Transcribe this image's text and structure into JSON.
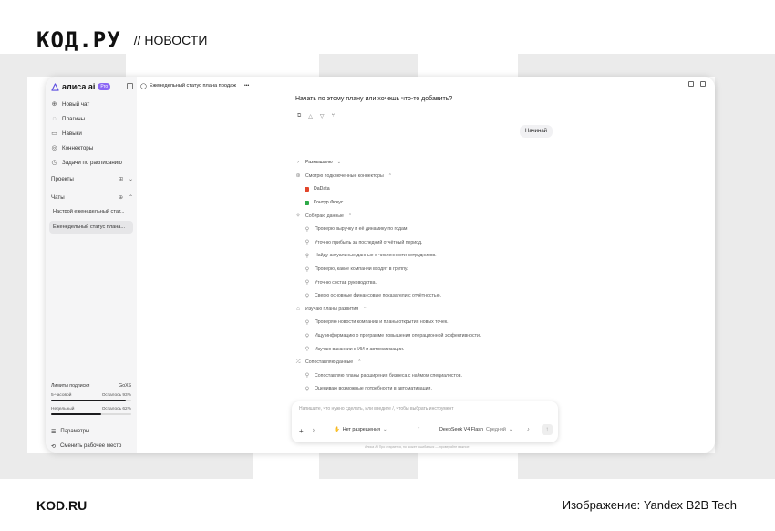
{
  "header": {
    "logo": "КОД.РУ",
    "section": "// НОВОСТИ"
  },
  "footer": {
    "site": "KOD.RU",
    "credit": "Изображение: Yandex B2B Tech"
  },
  "sidebar": {
    "logo_text": "алиса ai",
    "badge": "Pro",
    "nav": [
      {
        "label": "Новый чат",
        "icon": "plus-chat-icon"
      },
      {
        "label": "Плагины",
        "icon": "plugin-icon"
      },
      {
        "label": "Навыки",
        "icon": "book-icon"
      },
      {
        "label": "Коннекторы",
        "icon": "connector-icon"
      },
      {
        "label": "Задачи по расписанию",
        "icon": "clock-icon"
      }
    ],
    "projects_label": "Проекты",
    "chats_label": "Чаты",
    "chats": [
      {
        "label": "Настрой еженедельный стат..."
      },
      {
        "label": "Еженедельный статус плана..."
      }
    ],
    "limits": {
      "title": "Лимиты подписки",
      "plan": "GoXS",
      "rows": [
        {
          "label": "5-часовой",
          "value": "Осталось 93%",
          "fill": 0.93
        },
        {
          "label": "Недельный",
          "value": "Осталось 62%",
          "fill": 0.62
        }
      ]
    },
    "settings_label": "Параметры",
    "workspace_label": "Сменить рабочее место"
  },
  "main": {
    "chat_title": "Еженедельный статус плана продаж",
    "more": "•••",
    "question": "Начать по этому плану или хочешь что-то добавить?",
    "user_message": "Начинай",
    "thinking_label": "Размышляю",
    "steps": [
      {
        "kind": "group",
        "icon": "plug-icon",
        "text": "Смотрю подключенные коннекторы"
      },
      {
        "kind": "source",
        "color": "#e2452a",
        "text": "DaData"
      },
      {
        "kind": "source",
        "color": "#2eaa48",
        "text": "Контур.Фокус"
      },
      {
        "kind": "group",
        "icon": "sparkle-icon",
        "text": "Собираю данные"
      },
      {
        "kind": "item",
        "text": "Проверю выручку и её динамику по годам."
      },
      {
        "kind": "item",
        "text": "Уточню прибыль за последний отчётный период."
      },
      {
        "kind": "item",
        "text": "Найду актуальные данные о численности сотрудников."
      },
      {
        "kind": "item",
        "text": "Проверю, какие компании входят в группу."
      },
      {
        "kind": "item",
        "text": "Уточню состав руководства."
      },
      {
        "kind": "item",
        "text": "Сверю основные финансовые показатели с отчётностью."
      },
      {
        "kind": "group",
        "icon": "cap-icon",
        "text": "Изучаю планы развития"
      },
      {
        "kind": "item",
        "text": "Проверяю новости компании и планы открытия новых точек."
      },
      {
        "kind": "item",
        "text": "Ищу информацию о программе повышения операционной эффективности."
      },
      {
        "kind": "item",
        "text": "Изучаю вакансии в ИИ и автоматизации."
      },
      {
        "kind": "group",
        "icon": "merge-icon",
        "text": "Сопоставляю данные"
      },
      {
        "kind": "item",
        "text": "Сопоставляю планы расширения бизнеса с наймом специалистов."
      },
      {
        "kind": "item",
        "text": "Оцениваю возможные потребности в автоматизации."
      }
    ],
    "input": {
      "placeholder": "Напишите, что нужно сделать, или введите /, чтобы выбрать инструмент",
      "permissions": "Нет разрешения",
      "model": "DeepSeek V4 Flash",
      "mode": "Средний"
    },
    "disclaimer": "Алиса AI Про старается, но может ошибаться — проверяйте важное"
  }
}
